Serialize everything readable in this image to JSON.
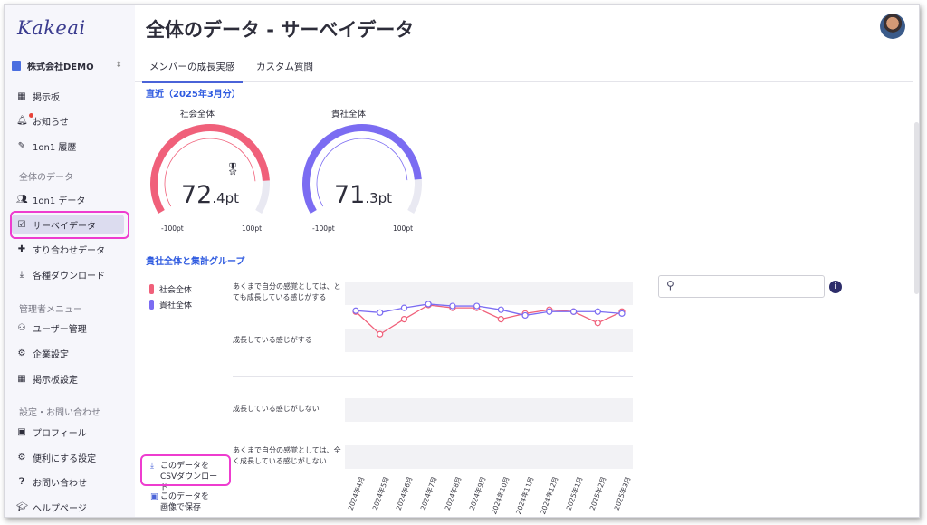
{
  "app": {
    "logo": "Kakeai",
    "company": "株式会社DEMO"
  },
  "sidebar": {
    "items_top": [
      {
        "label": "掲示板",
        "icon": "board-icon"
      },
      {
        "label": "お知らせ",
        "icon": "bell-icon"
      },
      {
        "label": "1on1 履歴",
        "icon": "history-icon"
      }
    ],
    "section_data": "全体のデータ",
    "items_data": [
      {
        "label": "1on1 データ",
        "icon": "people-icon"
      },
      {
        "label": "サーベイデータ",
        "icon": "survey-icon"
      },
      {
        "label": "すり合わせデータ",
        "icon": "puzzle-icon"
      },
      {
        "label": "各種ダウンロード",
        "icon": "download-icon"
      }
    ],
    "section_admin": "管理者メニュー",
    "items_admin": [
      {
        "label": "ユーザー管理",
        "icon": "users-icon"
      },
      {
        "label": "企業設定",
        "icon": "building-icon"
      },
      {
        "label": "掲示板設定",
        "icon": "board-icon"
      }
    ],
    "section_settings": "設定・お問い合わせ",
    "items_settings": [
      {
        "label": "プロフィール",
        "icon": "profile-icon"
      },
      {
        "label": "便利にする設定",
        "icon": "gear-icon"
      },
      {
        "label": "お問い合わせ",
        "icon": "help-icon"
      },
      {
        "label": "ヘルプページ",
        "icon": "graduation-icon"
      }
    ]
  },
  "header": {
    "title": "全体のデータ - サーベイデータ"
  },
  "tabs": [
    {
      "label": "メンバーの成長実感"
    },
    {
      "label": "カスタム質問"
    }
  ],
  "recent": {
    "title": "直近（2025年3月分）",
    "gauges": [
      {
        "label": "社会全体",
        "value_int": "72",
        "value_dec": ".4pt",
        "value": 72.4,
        "min_label": "-100pt",
        "max_label": "100pt",
        "color": "#f0607a"
      },
      {
        "label": "貴社全体",
        "value_int": "71",
        "value_dec": ".3pt",
        "value": 71.3,
        "min_label": "-100pt",
        "max_label": "100pt",
        "color": "#7b6cf2"
      }
    ]
  },
  "group": {
    "title": "貴社全体と集計グループ",
    "legend": [
      {
        "name": "社会全体",
        "color": "#f0607a"
      },
      {
        "name": "貴社全体",
        "color": "#7b6cf2"
      }
    ],
    "y_labels": [
      "あくまで自分の感覚としては、とても成長している感じがする",
      "成長している感じがする",
      "成長している感じがしない",
      "あくまで自分の感覚としては、全く成長している感じがしない"
    ],
    "actions": {
      "csv": "このデータをCSVダウンロード",
      "image": "このデータを画像で保存"
    }
  },
  "chart_data": {
    "type": "line",
    "categories": [
      "2024年4月",
      "2024年5月",
      "2024年6月",
      "2024年7月",
      "2024年8月",
      "2024年9月",
      "2024年10月",
      "2024年11月",
      "2024年12月",
      "2025年1月",
      "2025年2月",
      "2025年3月"
    ],
    "ylim": [
      -100,
      100
    ],
    "series": [
      {
        "name": "社会全体",
        "color": "#f0607a",
        "values": [
          68,
          44,
          60,
          75,
          72,
          72,
          60,
          66,
          70,
          68,
          56,
          68
        ]
      },
      {
        "name": "貴社全体",
        "color": "#7b6cf2",
        "values": [
          69,
          67,
          72,
          76,
          74,
          74,
          70,
          64,
          68,
          68,
          68,
          66
        ]
      }
    ]
  }
}
